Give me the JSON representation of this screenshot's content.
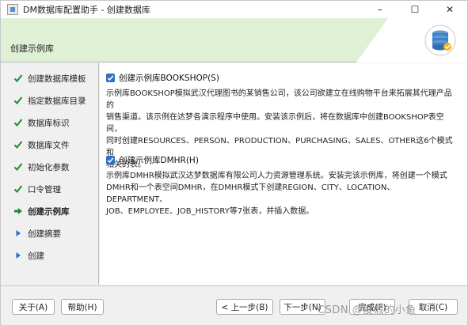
{
  "window": {
    "title": "DM数据库配置助手 - 创建数据库",
    "controls": {
      "minimize": "–",
      "maximize": "☐",
      "close": "✕"
    }
  },
  "header": {
    "title": "创建示例库"
  },
  "nav": {
    "items": [
      {
        "label": "创建数据库模板",
        "state": "done"
      },
      {
        "label": "指定数据库目录",
        "state": "done"
      },
      {
        "label": "数据库标识",
        "state": "done"
      },
      {
        "label": "数据库文件",
        "state": "done"
      },
      {
        "label": "初始化参数",
        "state": "done"
      },
      {
        "label": "口令管理",
        "state": "done"
      },
      {
        "label": "创建示例库",
        "state": "current"
      },
      {
        "label": "创建摘要",
        "state": "pending"
      },
      {
        "label": "创建",
        "state": "pending"
      }
    ]
  },
  "options": {
    "bookshop": {
      "label": "创建示例库BOOKSHOP(S)",
      "checked": true,
      "desc_lines": [
        "示例库BOOKSHOP模拟武汉代理图书的某销售公司，该公司欲建立在线购物平台来拓展其代理产品的",
        "销售渠道。该示例在达梦各演示程序中使用。安装该示例后，将在数据库中创建BOOKSHOP表空间，",
        "同时创建RESOURCES、PERSON、PRODUCTION、PURCHASING、SALES、OTHER这6个模式和",
        "相关的表。"
      ]
    },
    "dmhr": {
      "label": "创建示例库DMHR(H)",
      "checked": true,
      "desc_lines": [
        "示例库DMHR模拟武汉达梦数据库有限公司人力资源管理系统。安装完该示例库，将创建一个模式",
        "DMHR和一个表空间DMHR，在DMHR模式下创建REGION、CITY、LOCATION、DEPARTMENT、",
        "JOB、EMPLOYEE、JOB_HISTORY等7张表，并插入数据。"
      ]
    }
  },
  "footer": {
    "about": "关于(A)",
    "help": "帮助(H)",
    "back": "< 上一步(B)",
    "next": "下一步(N)",
    "finish": "完成(F)",
    "cancel": "取消(C)"
  },
  "watermark": "CSDN @度假的小鱼",
  "colors": {
    "header_bg": "#dff0d5",
    "checkbox": "#2f6fc9",
    "nav_check": "#1e8a2e",
    "nav_arrow": "#2f6fc9"
  }
}
